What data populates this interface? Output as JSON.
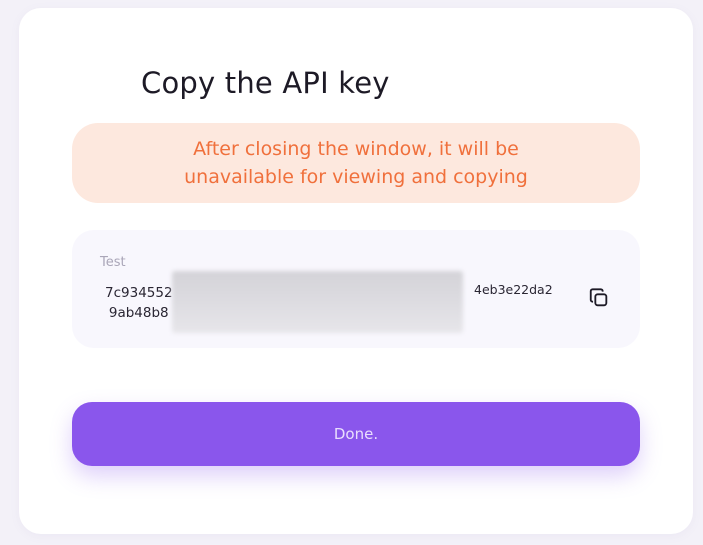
{
  "dialog": {
    "title": "Copy the API key",
    "warning": "After closing the window, it will be unavailable for viewing and copying",
    "key": {
      "name": "Test",
      "start_line1": "7c934552",
      "start_line2": "9ab48b8",
      "end": "4eb3e22da2"
    },
    "copy_icon": "copy-icon",
    "done_label": "Done."
  },
  "colors": {
    "accent": "#8a56ec",
    "warning_text": "#f0703c",
    "warning_bg": "#fde8de"
  }
}
